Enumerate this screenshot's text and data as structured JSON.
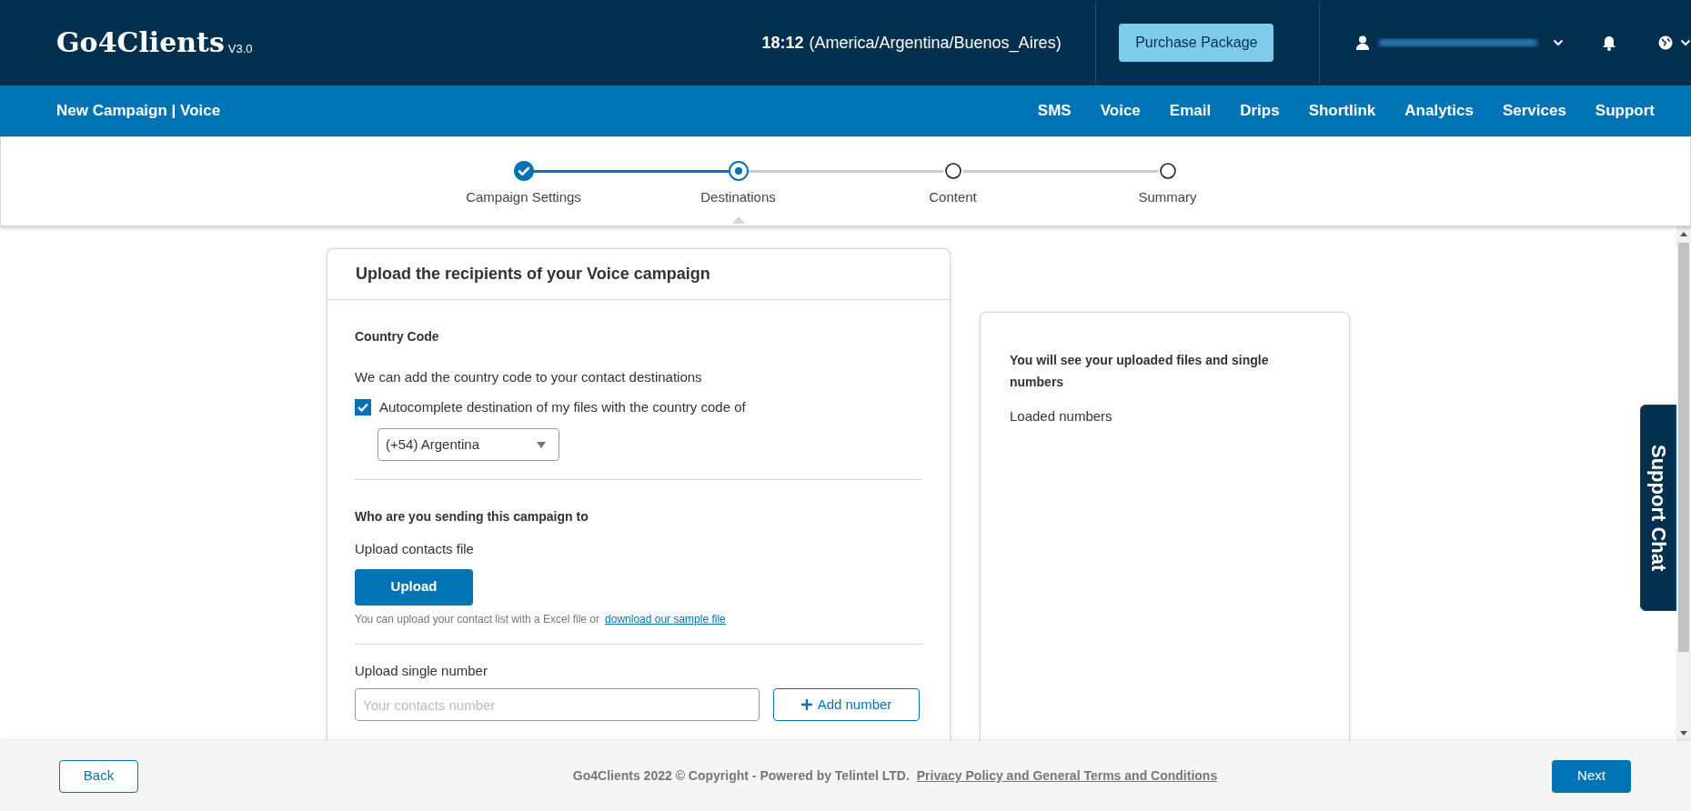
{
  "header": {
    "logo": "Go4Clients",
    "version": "V3.0",
    "time": "18:12",
    "timezone": "(America/Argentina/Buenos_Aires)",
    "purchase_button": "Purchase Package"
  },
  "nav": {
    "title": "New Campaign | Voice",
    "items": [
      {
        "label": "SMS"
      },
      {
        "label": "Voice"
      },
      {
        "label": "Email"
      },
      {
        "label": "Drips"
      },
      {
        "label": "Shortlink"
      },
      {
        "label": "Analytics"
      },
      {
        "label": "Services"
      },
      {
        "label": "Support"
      }
    ]
  },
  "stepper": {
    "steps": [
      {
        "label": "Campaign Settings",
        "kind": "done"
      },
      {
        "label": "Destinations",
        "kind": "current"
      },
      {
        "label": "Content",
        "kind": "todo"
      },
      {
        "label": "Summary",
        "kind": "todo"
      }
    ]
  },
  "upload_card": {
    "title": "Upload the recipients of your Voice campaign",
    "country_code": {
      "heading": "Country Code",
      "description": "We can add the country code to your contact destinations",
      "checkbox": {
        "label": "Autocomplete destination of my files with the country code of",
        "checked": true
      },
      "select": {
        "value": "(+54) Argentina"
      }
    },
    "recipients": {
      "heading": "Who are you sending this campaign to",
      "upload_label": "Upload contacts file",
      "upload_button": "Upload",
      "hint": "You can upload your contact list with a Excel file or",
      "link": "download our sample file"
    },
    "single_number": {
      "label": "Upload single number",
      "placeholder": "Your contacts number",
      "add_button": "Add number"
    }
  },
  "side_card": {
    "heading": "You will see your uploaded files and single numbers",
    "loaded_label": "Loaded numbers"
  },
  "support_chat": {
    "label": "Support Chat"
  },
  "footer": {
    "back_button": "Back",
    "copyright": "Go4Clients 2022 © Copyright - Powered by Telintel LTD.",
    "link": "Privacy Policy and General Terms and Conditions",
    "next_button": "Next"
  }
}
